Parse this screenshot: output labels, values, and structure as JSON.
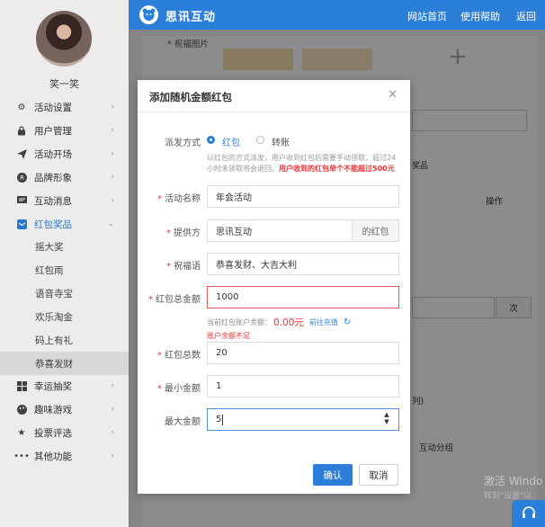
{
  "sidebar": {
    "username": "笑一笑",
    "items": [
      {
        "label": "活动设置",
        "icon": "gear-icon"
      },
      {
        "label": "用户管理",
        "icon": "lock-icon"
      },
      {
        "label": "活动开场",
        "icon": "send-icon"
      },
      {
        "label": "品牌形象",
        "icon": "registered-icon"
      },
      {
        "label": "互动消息",
        "icon": "message-icon"
      },
      {
        "label": "红包奖品",
        "icon": "gift-icon"
      }
    ],
    "subitems": [
      "摇大奖",
      "红包雨",
      "语音寺宝",
      "欢乐淘金",
      "码上有礼",
      "恭喜发财"
    ],
    "items_bottom": [
      {
        "label": "幸运抽奖",
        "icon": "grid-icon"
      },
      {
        "label": "趣味游戏",
        "icon": "palette-icon"
      },
      {
        "label": "投票评选",
        "icon": "star-icon"
      },
      {
        "label": "其他功能",
        "icon": "more-icon"
      }
    ]
  },
  "header": {
    "brand": "思讯互动",
    "links": [
      "网站首页",
      "使用帮助",
      "返回"
    ]
  },
  "background": {
    "blessing_image_label": "* 祝福图片",
    "tab_fragment": "奖品",
    "col_operation": "操作",
    "next_fragment": "次",
    "list_fragment": "列)",
    "group_label": "互动分组",
    "watermark_line1": "激活 Windo",
    "watermark_line2": "转到\"设置\"以"
  },
  "modal": {
    "title": "添加随机金额红包",
    "send_method_label": "派发方式",
    "options": [
      "红包",
      "转账"
    ],
    "hint_text": "以红包的方式派发，用户收到红包后需要手动领取，超过24小时未领取将会退回。",
    "hint_highlight": "用户收到的红包单个不能超过500元",
    "fields": {
      "activity_name": {
        "label": "活动名称",
        "value": "年会活动"
      },
      "provider": {
        "label": "提供方",
        "value": "思讯互动",
        "suffix": "的红包"
      },
      "blessing": {
        "label": "祝福语",
        "value": "恭喜发财、大吉大利"
      },
      "total_amount": {
        "label": "红包总金额",
        "value": "1000"
      },
      "balance_label": "当前红包账户余额：",
      "balance_value": "0.00元",
      "recharge_link": "前往充值",
      "error_text": "账户余额不足",
      "count": {
        "label": "红包总数",
        "value": "20"
      },
      "min_amount": {
        "label": "最小金额",
        "value": "1"
      },
      "max_amount": {
        "label": "最大金额",
        "value": "5"
      }
    },
    "confirm": "确认",
    "cancel": "取消"
  },
  "colors": {
    "primary": "#2b7fd8",
    "error": "#e33333"
  }
}
